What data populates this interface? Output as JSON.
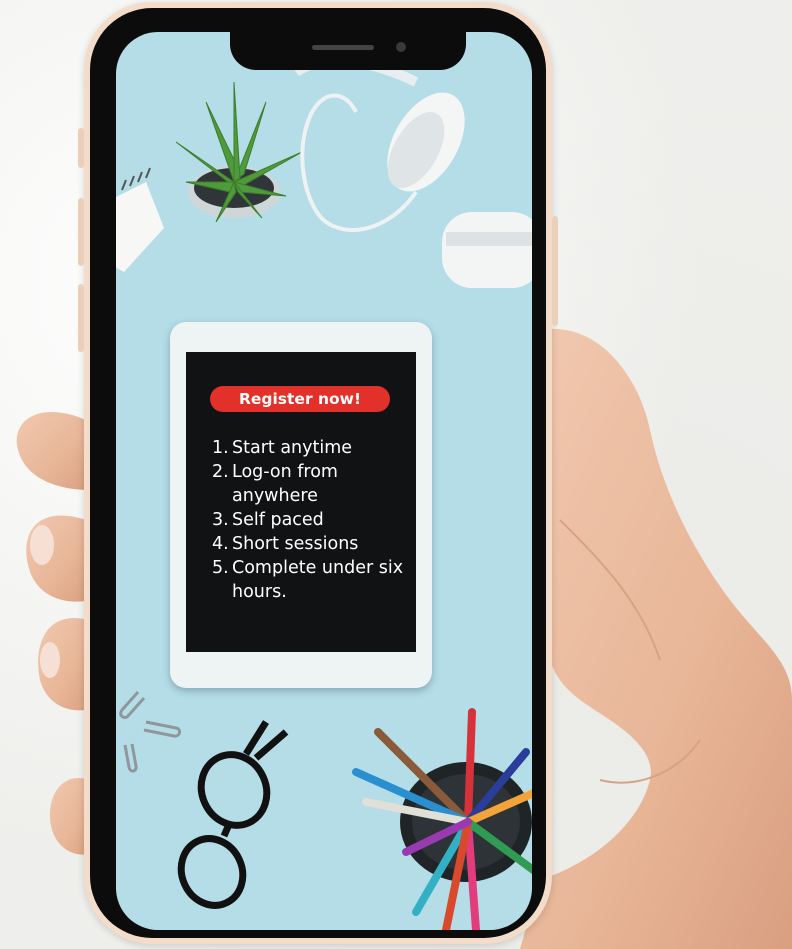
{
  "scene": {
    "description_text": "",
    "colors": {
      "background": "#f4f4f2",
      "phone_frame": "#f3dcc9",
      "screen_wallpaper": "#b5dde8",
      "badge": "#e2302b",
      "tablet_screen": "#111214"
    }
  },
  "tablet": {
    "badge_label": "Register now!",
    "steps": [
      {
        "num": "1.",
        "text": "Start anytime"
      },
      {
        "num": "2.",
        "text": "Log-on from anywhere"
      },
      {
        "num": "3.",
        "text": "Self paced"
      },
      {
        "num": "4.",
        "text": "Short sessions"
      },
      {
        "num": "5.",
        "text": "Complete under six hours."
      }
    ]
  },
  "icons": [
    "plant-icon",
    "headphones-icon",
    "notepad-icon",
    "paperclip-icon",
    "eyeglasses-icon",
    "pencil-cup-icon",
    "hand-icon"
  ]
}
